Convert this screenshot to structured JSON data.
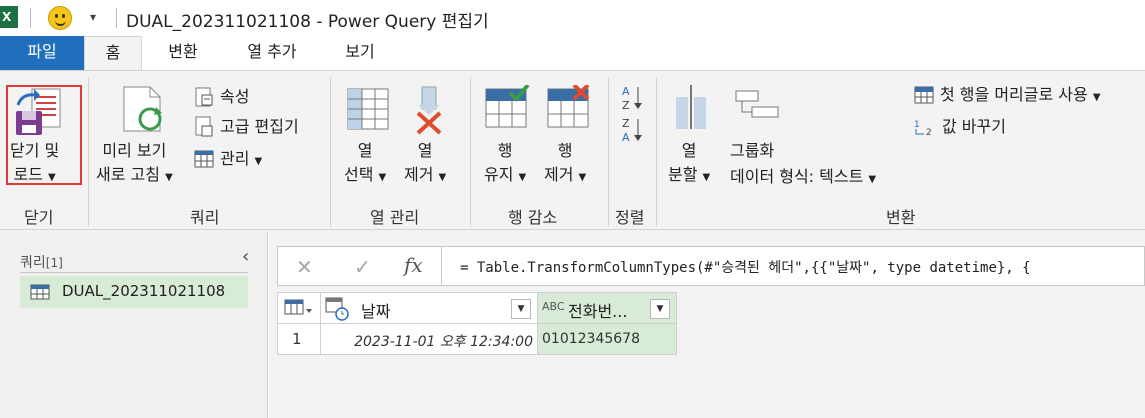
{
  "titlebar": {
    "app_icon": "X",
    "qa_customize": "▾",
    "title": "DUAL_202311021108 - Power Query 편집기"
  },
  "tabs": [
    "파일",
    "홈",
    "변환",
    "열 추가",
    "보기"
  ],
  "ribbon": {
    "close": {
      "button": [
        "닫기 및",
        "로드"
      ],
      "group": "닫기"
    },
    "query": {
      "refresh": [
        "미리 보기",
        "새로 고침"
      ],
      "properties": "속성",
      "advanced_editor": "고급 편집기",
      "manage": "관리",
      "group": "쿼리"
    },
    "manage_columns": {
      "choose": [
        "열",
        "선택"
      ],
      "remove": [
        "열",
        "제거"
      ],
      "group": "열 관리"
    },
    "reduce_rows": {
      "keep": [
        "행",
        "유지"
      ],
      "remove": [
        "행",
        "제거"
      ],
      "group": "행 감소"
    },
    "sort": {
      "group": "정렬"
    },
    "transform": {
      "split": [
        "열",
        "분할"
      ],
      "group_by": "그룹화",
      "data_type": "데이터 형식: 텍스트",
      "first_row_header": "첫 행을 머리글로 사용",
      "replace_values": "값 바꾸기",
      "group": "변환"
    }
  },
  "query_pane": {
    "header": "쿼리",
    "count": "[1]",
    "collapse": "‹",
    "items": [
      "DUAL_202311021108"
    ]
  },
  "formula_bar": {
    "cancel": "✕",
    "confirm": "✓",
    "fx": "fx",
    "formula": "= Table.TransformColumnTypes(#\"승격된 헤더\",{{\"날짜\", type datetime}, {"
  },
  "table": {
    "columns": [
      {
        "name": "날짜",
        "type_icon": "datetime-icon"
      },
      {
        "name": "전화번...",
        "type_icon": "ABC"
      }
    ],
    "rows": [
      {
        "num": "1",
        "cells": [
          "2023-11-01 오후 12:34:00",
          "01012345678"
        ]
      }
    ]
  },
  "colors": {
    "file_tab": "#1f6fbd",
    "highlight": "#e23a3a",
    "selected": "#d7ebd6"
  }
}
